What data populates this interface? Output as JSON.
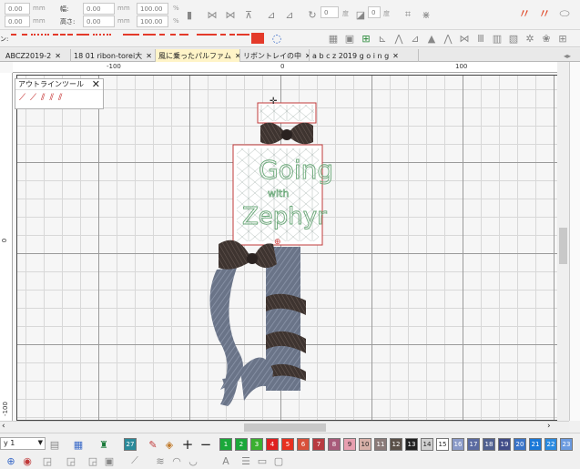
{
  "toolbar": {
    "x_value": "0.00",
    "y_value": "0.00",
    "unit_mm": "mm",
    "width_label": "幅:",
    "height_label": "高さ:",
    "width_value": "0.00",
    "height_value": "0.00",
    "scale_w": "100.00",
    "scale_h": "100.00",
    "pct": "%",
    "rotate_value": "0",
    "slant_value": "0",
    "deg": "度"
  },
  "stitch_row": {
    "label": "ン:"
  },
  "tabs": [
    {
      "label": "ABCZ2019-2",
      "active": false
    },
    {
      "label": "18 01 ribon-torei大",
      "active": false
    },
    {
      "label": "風に乗ったパルファム",
      "active": true
    },
    {
      "label": "リボントレイの中",
      "active": false
    },
    {
      "label": "a b c z 2019 g o i n g",
      "active": false
    }
  ],
  "ruler": {
    "top": [
      "-100",
      "0",
      "100"
    ],
    "left": [
      "0",
      "-100"
    ]
  },
  "outline_tool": {
    "title": "アウトラインツール"
  },
  "design": {
    "text_line1": "Going",
    "text_line2": "with",
    "text_line3": "Zephyr"
  },
  "bottom": {
    "layer_value": "y 1",
    "swatch_27": "27",
    "swatches": [
      {
        "n": "1",
        "color": "#1aa83a"
      },
      {
        "n": "2",
        "color": "#1aa83a"
      },
      {
        "n": "3",
        "color": "#3ab030"
      },
      {
        "n": "4",
        "color": "#e02020"
      },
      {
        "n": "5",
        "color": "#e83020"
      },
      {
        "n": "6",
        "color": "#d8503a"
      },
      {
        "n": "7",
        "color": "#b83a40"
      },
      {
        "n": "8",
        "color": "#a85a7a"
      },
      {
        "n": "9",
        "color": "#e8a0b0"
      },
      {
        "n": "10",
        "color": "#d8b0a8"
      },
      {
        "n": "11",
        "color": "#8a7a78"
      },
      {
        "n": "12",
        "color": "#5a5048"
      },
      {
        "n": "13",
        "color": "#202020"
      },
      {
        "n": "14",
        "color": "#d0d0d0"
      },
      {
        "n": "15",
        "color": "#ffffff"
      },
      {
        "n": "16",
        "color": "#8a9ac8"
      },
      {
        "n": "17",
        "color": "#5a6aa0"
      },
      {
        "n": "18",
        "color": "#506090"
      },
      {
        "n": "19",
        "color": "#404c88"
      },
      {
        "n": "20",
        "color": "#3a74c8"
      },
      {
        "n": "21",
        "color": "#1a78d8"
      },
      {
        "n": "22",
        "color": "#2a8ae0"
      },
      {
        "n": "23",
        "color": "#6a9ae0"
      }
    ]
  }
}
